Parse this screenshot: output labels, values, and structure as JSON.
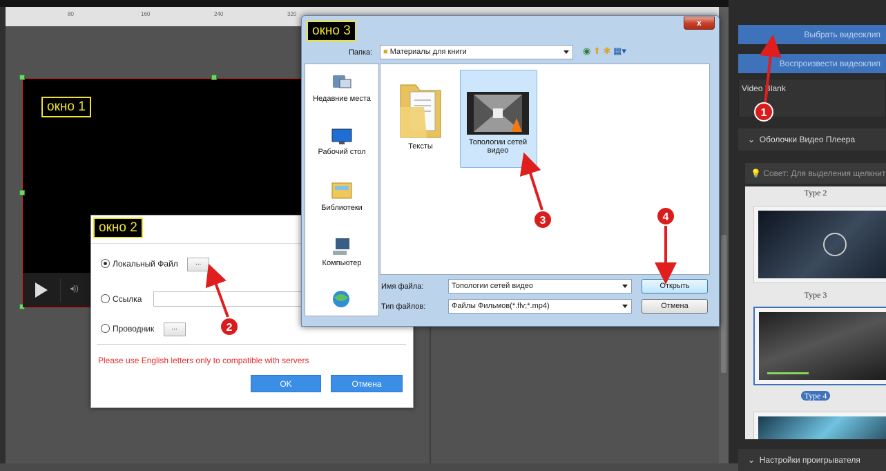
{
  "ruler": {
    "labels": [
      "80",
      "160",
      "240",
      "320"
    ]
  },
  "labels": {
    "window1": "окно 1",
    "window2": "окно 2",
    "window3": "окно 3"
  },
  "right_panel": {
    "choose_clip_button": "Выбрать видеоклип",
    "play_clip_button": "Воспроизвести видеоклип",
    "clip_name": "Video Blank",
    "skins_header": "Оболочки Видео Плеера",
    "tip": "Совет: Для выделения щелкните",
    "type2_label": "Type 2",
    "type3_label": "Type 3",
    "type4_label": "Type 4",
    "player_settings_header": "Настройки проигрывателя"
  },
  "window2": {
    "local_file_label": "Локальный Файл",
    "browse_button": "...",
    "link_label": "Ссылка",
    "explorer_label": "Проводник",
    "explorer_button": "...",
    "warning": "Please use English letters only to compatible with servers",
    "ok_button": "OK",
    "cancel_button": "Отмена"
  },
  "window3": {
    "close_button": "x",
    "folder_label": "Папка:",
    "folder_value": "Материалы для книги",
    "places": [
      {
        "label": "Недавние места"
      },
      {
        "label": "Рабочий стол"
      },
      {
        "label": "Библиотеки"
      },
      {
        "label": "Компьютер"
      }
    ],
    "files": [
      {
        "name": "Тексты"
      },
      {
        "name": "Топологии сетей видео"
      }
    ],
    "filename_label": "Имя файла:",
    "filename_value": "Топологии сетей видео",
    "filetype_label": "Тип файлов:",
    "filetype_value": "Файлы Фильмов(*.flv;*.mp4)",
    "open_button": "Открыть",
    "cancel_button": "Отмена"
  },
  "badges": [
    "1",
    "2",
    "3",
    "4"
  ],
  "colors": {
    "accent_blue": "#3e72bb",
    "badge_red": "#d91c1c",
    "label_yellow": "#f0e32a",
    "warning_red": "#e32b2b"
  }
}
